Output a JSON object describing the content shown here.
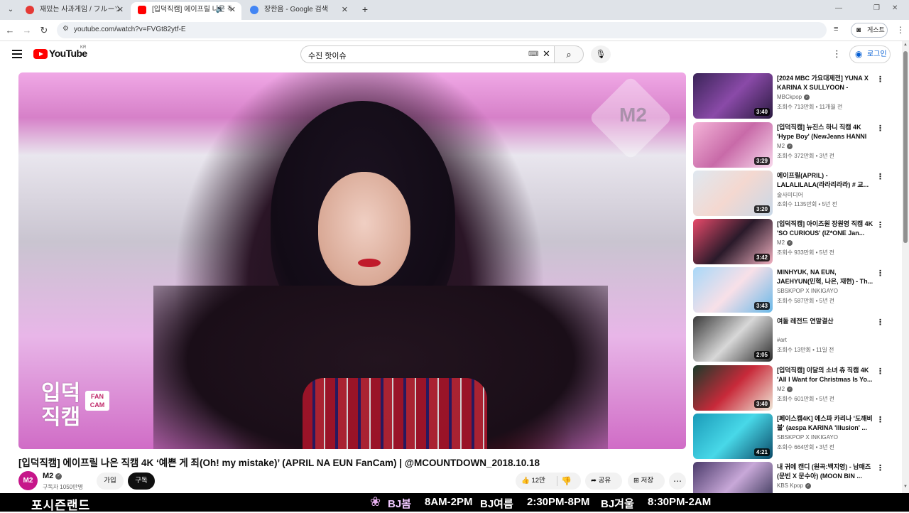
{
  "browser": {
    "tabs": [
      {
        "title": "재밌는 사과게임 / フルーツボックス",
        "favicon_color": "#e53935",
        "active": false
      },
      {
        "title": "[입덕직캠] 에이프릴 나은 직캠",
        "favicon_color": "#ff0000",
        "active": true
      },
      {
        "title": "장한음 - Google 검색",
        "favicon_color": "#4285f4",
        "active": false
      }
    ],
    "url": "youtube.com/watch?v=FVGt82ytf-E",
    "guest_label": "게스트"
  },
  "youtube": {
    "logo_text": "YouTube",
    "region": "KR",
    "search_value": "수진 핫이슈",
    "login_label": "로그인"
  },
  "video": {
    "watermark": "M2",
    "overlay_logo_line1": "입덕",
    "overlay_logo_line2": "직캠",
    "overlay_badge": "FAN CAM",
    "title": "[입덕직캠] 에이프릴 나은 직캠 4K ‘예쁜 게 죄(Oh! my mistake)’ (APRIL NA EUN FanCam) | @MCOUNTDOWN_2018.10.18",
    "channel_name": "M2",
    "channel_avatar": "M2",
    "subscribers": "구독자 1050만명",
    "join_label": "가입",
    "subscribe_label": "구독",
    "likes": "12만",
    "share_label": "공유",
    "save_label": "저장"
  },
  "recommendations": [
    {
      "title": "[2024 MBC 가요대제전] YUNA X KARINA X SULLYOON - pocket...",
      "channel": "MBCkpop",
      "verified": true,
      "meta": "조회수 713만회 • 11개월 전",
      "duration": "3:40",
      "thumb": "linear-gradient(135deg,#3a2458,#8a4aa8 50%,#2a1a40)"
    },
    {
      "title": "[입덕직캠] 뉴진스 하니 직캠 4K 'Hype Boy' (NewJeans HANNI ...",
      "channel": "M2",
      "verified": true,
      "meta": "조회수 372만회 • 3년 전",
      "duration": "3:29",
      "thumb": "linear-gradient(135deg,#f4b4d8,#c86aa8 50%,#f8d8ec)"
    },
    {
      "title": "에이프릴(APRIL) - LALALILALA(라라리라라) # 교...",
      "channel": "술사미디어",
      "verified": false,
      "meta": "조회수 1135만회 • 5년 전",
      "duration": "3:20",
      "thumb": "linear-gradient(135deg,#dfe8f0,#f4d8d0 50%,#c8d8e8)"
    },
    {
      "title": "[입덕직캠] 아이즈원 장원영 직캠 4K 'SO CURIOUS' (IZ*ONE Jan...",
      "channel": "M2",
      "verified": true,
      "meta": "조회수 933만회 • 5년 전",
      "duration": "3:42",
      "thumb": "linear-gradient(135deg,#e84a6a,#2a1a2a 50%,#f0b0c0)"
    },
    {
      "title": "MINHYUK, NA EUN, JAEHYUN(민혁, 나은, 재현) - Th...",
      "channel": "SBSKPOP X INKIGAYO",
      "verified": false,
      "meta": "조회수 587만회 • 5년 전",
      "duration": "3:43",
      "thumb": "linear-gradient(135deg,#a8d8f8,#f8e0e8 50%,#68b8e8)"
    },
    {
      "title": "여돌 레전드 연말결산",
      "channel": "#art",
      "verified": false,
      "meta": "조회수 13만회 • 11일 전",
      "duration": "2:05",
      "thumb": "linear-gradient(135deg,#3a3a3a,#d8d8d8 50%,#2a2a2a)"
    },
    {
      "title": "[입덕직캠] 이달의 소녀 츄 직캠 4K 'All I Want for Christmas Is Yo...",
      "channel": "M2",
      "verified": true,
      "meta": "조회수 601만회 • 5년 전",
      "duration": "3:40",
      "thumb": "linear-gradient(135deg,#1a3a2a,#c82a3a 50%,#f0e8d8)"
    },
    {
      "title": "[페이스캠4K] 에스파 카리나 '도깨비불' (aespa KARINA 'Illusion' ...",
      "channel": "SBSKPOP X INKIGAYO",
      "verified": false,
      "meta": "조회수 664만회 • 3년 전",
      "duration": "4:21",
      "thumb": "linear-gradient(135deg,#1a9ab8,#48d8e8 50%,#0a4a68)"
    },
    {
      "title": "내 귀에 캔디 (원곡:백지영) - 남매즈 (문빈 X 문수아) (MOON BIN ...",
      "channel": "KBS Kpop",
      "verified": true,
      "meta": "",
      "duration": "",
      "thumb": "linear-gradient(135deg,#4a3a6a,#c8a8d8 50%,#2a2a4a)"
    }
  ],
  "banner": {
    "brand": "포시즌랜드",
    "items": [
      {
        "label": "BJ봄",
        "time": "8AM-2PM"
      },
      {
        "label": "BJ여름",
        "time": "2:30PM-8PM"
      },
      {
        "label": "BJ겨울",
        "time": "8:30PM-2AM"
      }
    ]
  },
  "colors": {
    "youtube_red": "#ff0000",
    "link_blue": "#065fd4",
    "channel_pink": "#c6168a"
  },
  "icons": [
    "tab-search-icon",
    "audio-icon",
    "close-icon",
    "new-tab-icon",
    "back-icon",
    "forward-icon",
    "reload-icon",
    "site-info-icon",
    "reader-mode-icon",
    "profile-icon",
    "kebab-menu-icon",
    "hamburger-icon",
    "keyboard-icon",
    "clear-icon",
    "search-icon",
    "mic-icon",
    "user-icon",
    "like-icon",
    "dislike-icon",
    "share-icon",
    "save-icon",
    "more-icon"
  ]
}
